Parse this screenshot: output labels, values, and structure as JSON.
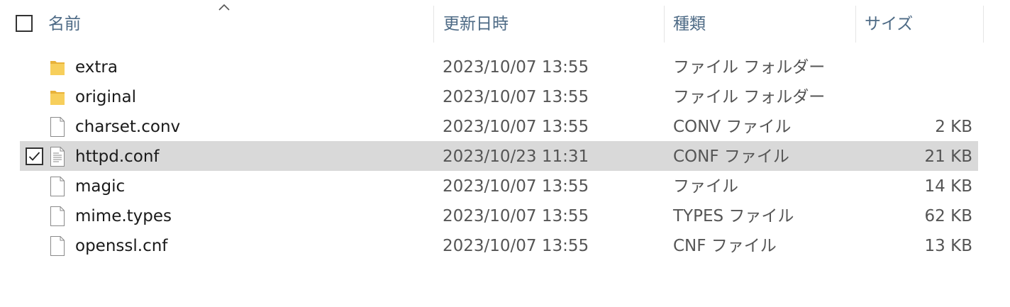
{
  "columns": {
    "name": "名前",
    "date_modified": "更新日時",
    "type": "種類",
    "size": "サイズ"
  },
  "sort": {
    "column": "name",
    "direction": "ascending",
    "indicator_icon": "caret-up-icon"
  },
  "files": [
    {
      "name": "extra",
      "date": "2023/10/07 13:55",
      "type": "ファイル フォルダー",
      "size": "",
      "icon": "folder-icon",
      "selected": false
    },
    {
      "name": "original",
      "date": "2023/10/07 13:55",
      "type": "ファイル フォルダー",
      "size": "",
      "icon": "folder-icon",
      "selected": false
    },
    {
      "name": "charset.conv",
      "date": "2023/10/07 13:55",
      "type": "CONV ファイル",
      "size": "2 KB",
      "icon": "file-icon",
      "selected": false
    },
    {
      "name": "httpd.conf",
      "date": "2023/10/23 11:31",
      "type": "CONF ファイル",
      "size": "21 KB",
      "icon": "text-file-icon",
      "selected": true
    },
    {
      "name": "magic",
      "date": "2023/10/07 13:55",
      "type": "ファイル",
      "size": "14 KB",
      "icon": "file-icon",
      "selected": false
    },
    {
      "name": "mime.types",
      "date": "2023/10/07 13:55",
      "type": "TYPES ファイル",
      "size": "62 KB",
      "icon": "file-icon",
      "selected": false
    },
    {
      "name": "openssl.cnf",
      "date": "2023/10/07 13:55",
      "type": "CNF ファイル",
      "size": "13 KB",
      "icon": "file-icon",
      "selected": false
    }
  ],
  "colors": {
    "header_text": "#4d6a85",
    "selected_row": "#d9d9d9",
    "folder": "#f4c54a"
  }
}
